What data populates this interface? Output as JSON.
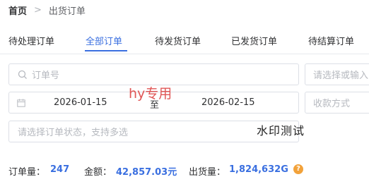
{
  "breadcrumb": {
    "home": "首页",
    "separator": ">",
    "current": "出货订单"
  },
  "tabs": [
    {
      "label": "待处理订单",
      "active": false
    },
    {
      "label": "全部订单",
      "active": true
    },
    {
      "label": "待发货订单",
      "active": false
    },
    {
      "label": "已发货订单",
      "active": false
    },
    {
      "label": "待结算订单",
      "active": false
    }
  ],
  "filters": {
    "order_no_placeholder": "订单号",
    "select_input_placeholder": "请选择或输入",
    "date_start": "2026-01-15",
    "date_separator": "至",
    "date_end": "2026-02-15",
    "payment_placeholder": "收款方式",
    "status_placeholder": "请选择订单状态，支持多选"
  },
  "watermarks": {
    "red": "hy专用",
    "black": "水印测试"
  },
  "stats": {
    "order_count_label": "订单量：",
    "order_count": "247",
    "amount_label": "金额：",
    "amount": "42,857.03元",
    "volume_label": "出货量：",
    "volume": "1,824,632G"
  },
  "icons": {
    "search": "search-icon",
    "calendar": "calendar-icon",
    "help": "help-icon"
  },
  "colors": {
    "accent": "#3a6fe0",
    "help": "#f2a23a",
    "watermark_red": "#e05656"
  }
}
